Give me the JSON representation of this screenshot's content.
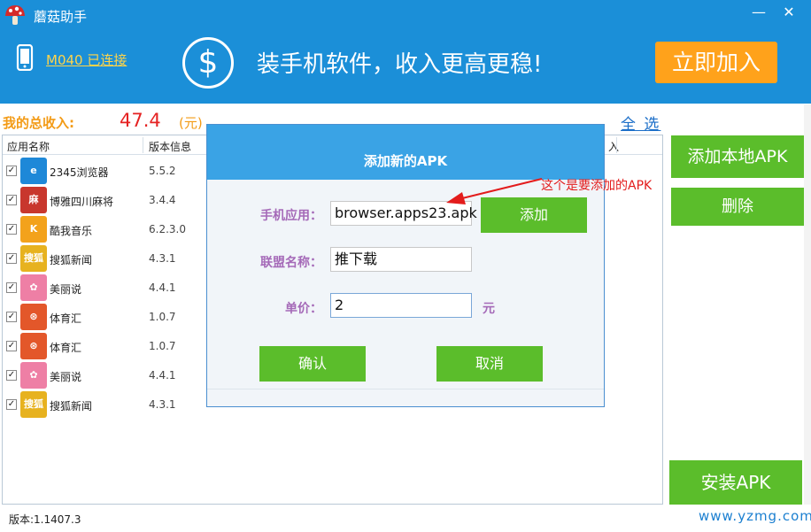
{
  "window": {
    "title": "蘑菇助手",
    "minimize": "—",
    "close": "✕"
  },
  "banner": {
    "device_link": "M040 已连接",
    "dollar_symbol": "$",
    "slogan": "装手机软件，收入更高更稳!",
    "join_button": "立即加入"
  },
  "income": {
    "label": "我的总收入:",
    "value": "47.4",
    "unit": "(元)"
  },
  "select_all": "全 选",
  "table": {
    "headers": [
      "应用名称",
      "版本信息",
      "入"
    ],
    "rows": [
      {
        "name": "2345浏览器",
        "version": "5.5.2",
        "icon": "e",
        "icon_color": "#1e88d8",
        "checked": "✓"
      },
      {
        "name": "博雅四川麻将",
        "version": "3.4.4",
        "icon": "麻",
        "icon_color": "#c8372d",
        "checked": "✓"
      },
      {
        "name": "酷我音乐",
        "version": "6.2.3.0",
        "icon": "K",
        "icon_color": "#f3a21b",
        "checked": "✓"
      },
      {
        "name": "搜狐新闻",
        "version": "4.3.1",
        "icon": "搜狐",
        "icon_color": "#e7b21f",
        "checked": "✓"
      },
      {
        "name": "美丽说",
        "version": "4.4.1",
        "icon": "✿",
        "icon_color": "#ee7fa5",
        "checked": "✓"
      },
      {
        "name": "体育汇",
        "version": "1.0.7",
        "icon": "⊛",
        "icon_color": "#e3572a",
        "checked": "✓"
      },
      {
        "name": "体育汇",
        "version": "1.0.7",
        "icon": "⊛",
        "icon_color": "#e3572a",
        "checked": "✓"
      },
      {
        "name": "美丽说",
        "version": "4.4.1",
        "icon": "✿",
        "icon_color": "#ee7fa5",
        "checked": "✓"
      },
      {
        "name": "搜狐新闻",
        "version": "4.3.1",
        "icon": "搜狐",
        "icon_color": "#e7b21f",
        "checked": "✓"
      }
    ]
  },
  "side_buttons": {
    "add_local": "添加本地APK",
    "delete": "删除",
    "install": "安装APK"
  },
  "status": {
    "version": "版本:1.1407.3",
    "watermark": "www.yzmg.com"
  },
  "dialog": {
    "title": "添加新的APK",
    "app_label": "手机应用：",
    "app_value": "browser.apps23.apk",
    "add_button": "添加",
    "union_label": "联盟名称：",
    "union_value": "推下载",
    "price_label": "单价：",
    "price_value": "2",
    "price_unit": "元",
    "confirm_button": "确认",
    "cancel_button": "取消"
  },
  "annotation": "这个是要添加的APK",
  "colors": {
    "brand_blue": "#1b8fd8",
    "button_green": "#5bbd2b",
    "join_orange": "#ffa21b",
    "income_red": "#e52222"
  }
}
